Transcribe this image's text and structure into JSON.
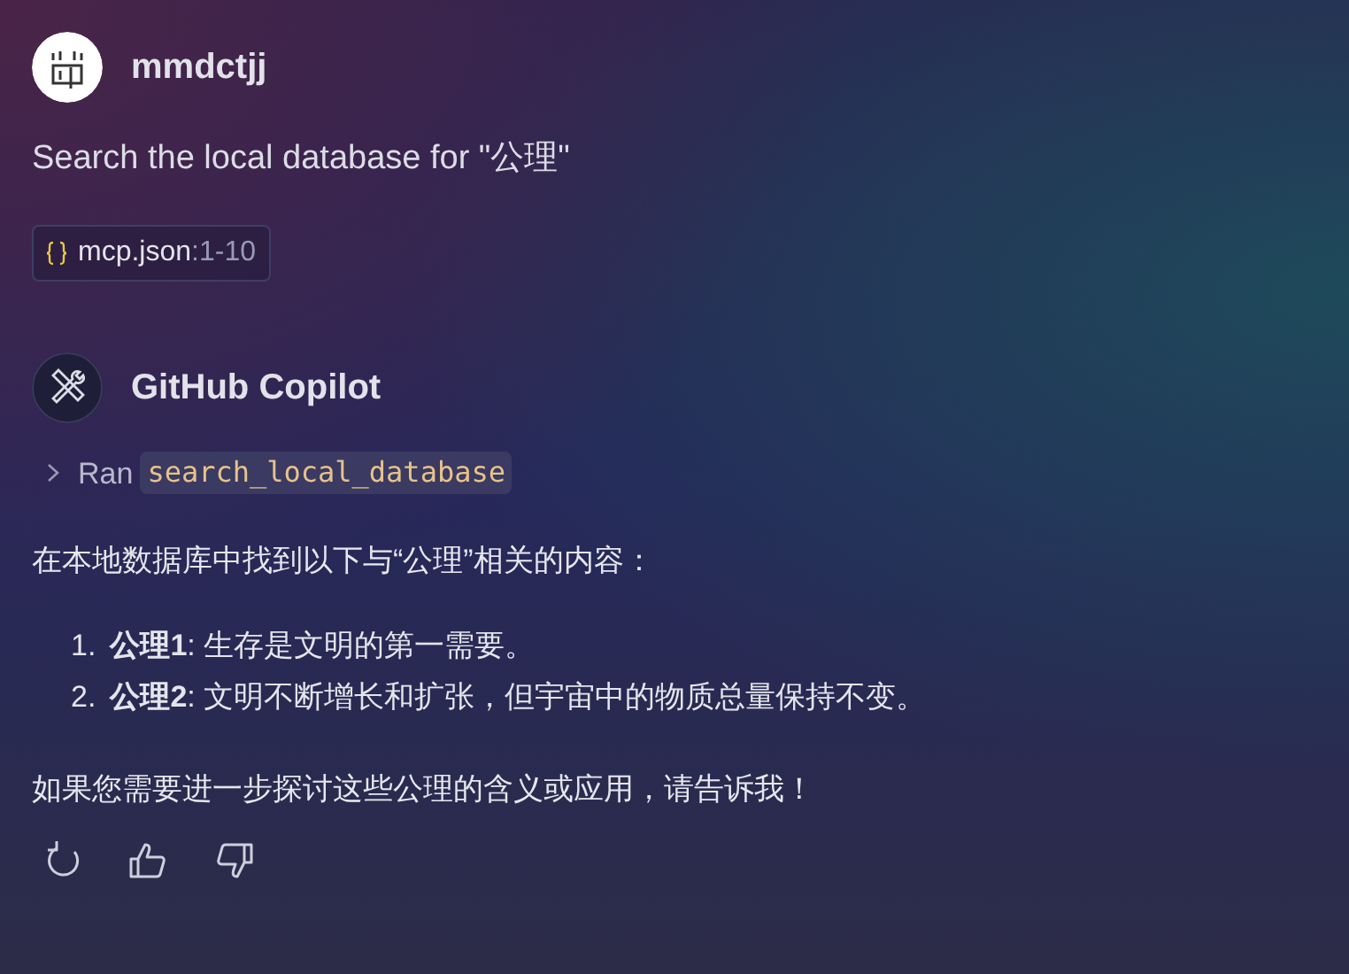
{
  "user": {
    "name": "mmdctjj",
    "message": "Search the local database for \"公理\"",
    "reference": {
      "file": "mcp.json",
      "range": ":1-10"
    }
  },
  "assistant": {
    "name": "GitHub Copilot",
    "tool_call": {
      "expanded": false,
      "verb": "Ran",
      "tool": "search_local_database"
    },
    "intro": "在本地数据库中找到以下与“公理”相关的内容：",
    "items": [
      {
        "number": "1.",
        "text": "**公理1**: 生存是文明的第一需要。"
      },
      {
        "number": "2.",
        "text": "**公理2**: 文明不断增长和扩张，但宇宙中的物质总量保持不变。"
      }
    ],
    "closing": "如果您需要进一步探讨这些公理的含义或应用，请告诉我！"
  }
}
